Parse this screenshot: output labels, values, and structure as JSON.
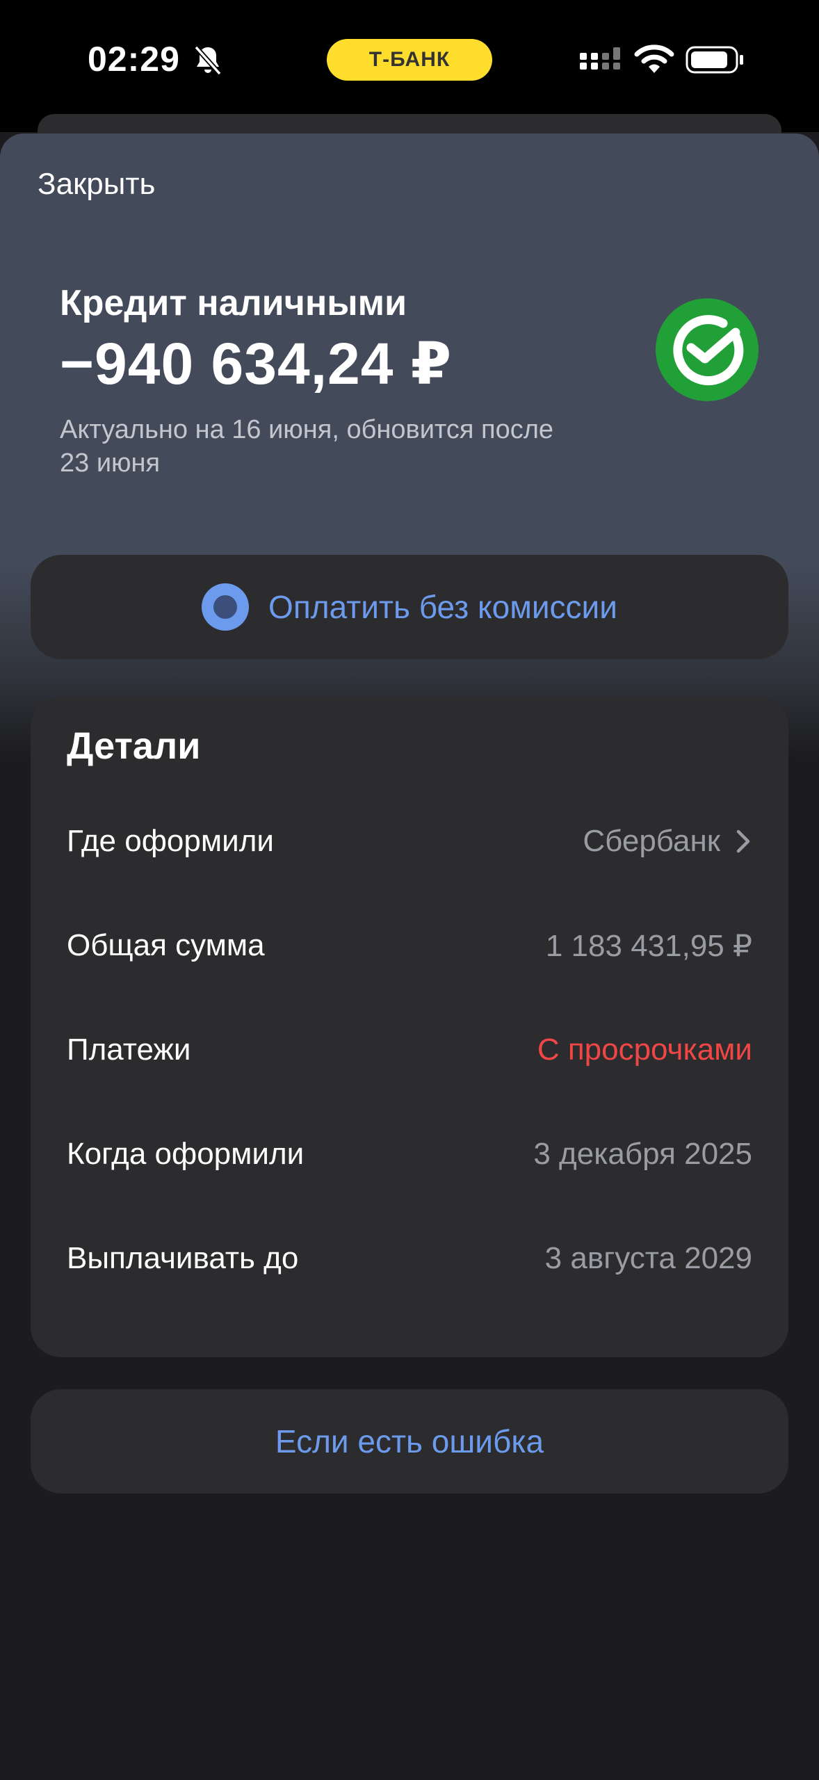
{
  "status_bar": {
    "time": "02:29",
    "pill_label": "Т-БАНК"
  },
  "header": {
    "close_label": "Закрыть",
    "loan_title": "Кредит наличными",
    "amount": "−940 634,24 ₽",
    "updated_note": "Актуально на 16 июня, обновится после 23 июня",
    "bank_logo_icon": "sberbank-logo-icon"
  },
  "pay_button": {
    "label": "Оплатить без комиссии",
    "icon": "pay-icon"
  },
  "details": {
    "title": "Детали",
    "rows": [
      {
        "label": "Где оформили",
        "value": "Сбербанк"
      },
      {
        "label": "Общая сумма",
        "value": "1 183 431,95 ₽"
      },
      {
        "label": "Платежи",
        "value": "С просрочками"
      },
      {
        "label": "Когда оформили",
        "value": "3 декабря 2025"
      },
      {
        "label": "Выплачивать до",
        "value": "3 августа 2029"
      }
    ]
  },
  "error_button": {
    "label": "Если есть ошибка"
  },
  "colors": {
    "accent_blue": "#6c9bed",
    "alert_red": "#f04646",
    "brand_yellow": "#ffdd2d",
    "sber_green": "#21a038"
  }
}
